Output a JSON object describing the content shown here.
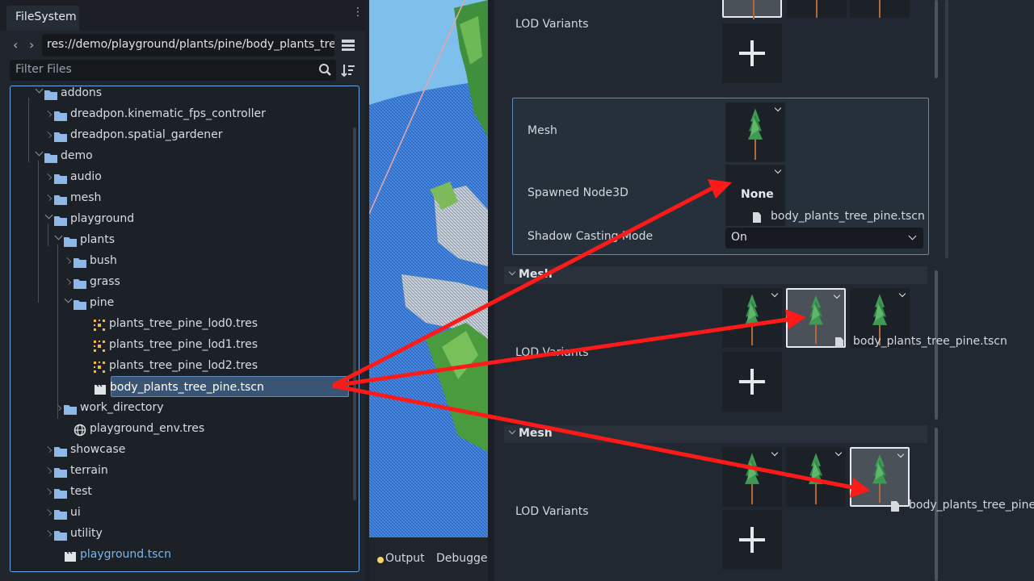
{
  "dock": {
    "tab": "FileSystem",
    "path": "res://demo/playground/plants/pine/body_plants_tree",
    "filter_placeholder": "Filter Files"
  },
  "tree": [
    {
      "label": "addons",
      "type": "folder",
      "state": "expanded"
    },
    {
      "label": "dreadpon.kinematic_fps_controller",
      "type": "folder",
      "state": "collapsed"
    },
    {
      "label": "dreadpon.spatial_gardener",
      "type": "folder",
      "state": "collapsed"
    },
    {
      "label": "demo",
      "type": "folder",
      "state": "expanded"
    },
    {
      "label": "audio",
      "type": "folder",
      "state": "collapsed"
    },
    {
      "label": "mesh",
      "type": "folder",
      "state": "collapsed"
    },
    {
      "label": "playground",
      "type": "folder",
      "state": "expanded"
    },
    {
      "label": "plants",
      "type": "folder",
      "state": "expanded"
    },
    {
      "label": "bush",
      "type": "folder",
      "state": "collapsed"
    },
    {
      "label": "grass",
      "type": "folder",
      "state": "collapsed"
    },
    {
      "label": "pine",
      "type": "folder",
      "state": "expanded"
    },
    {
      "label": "plants_tree_pine_lod0.tres",
      "type": "mesh-resource"
    },
    {
      "label": "plants_tree_pine_lod1.tres",
      "type": "mesh-resource"
    },
    {
      "label": "plants_tree_pine_lod2.tres",
      "type": "mesh-resource"
    },
    {
      "label": "body_plants_tree_pine.tscn",
      "type": "scene",
      "selected": true
    },
    {
      "label": "work_directory",
      "type": "folder",
      "state": "collapsed"
    },
    {
      "label": "playground_env.tres",
      "type": "environment"
    },
    {
      "label": "showcase",
      "type": "folder",
      "state": "collapsed"
    },
    {
      "label": "terrain",
      "type": "folder",
      "state": "collapsed"
    },
    {
      "label": "test",
      "type": "folder",
      "state": "collapsed"
    },
    {
      "label": "ui",
      "type": "folder",
      "state": "collapsed"
    },
    {
      "label": "utility",
      "type": "folder",
      "state": "collapsed"
    },
    {
      "label": "playground.tscn",
      "type": "scene",
      "highlight": true
    }
  ],
  "bottom_panel": {
    "output": "Output",
    "debugger": "Debugger"
  },
  "inspector": {
    "lod_variants_label": "LOD Variants",
    "mesh_label": "Mesh",
    "spawned_label": "Spawned Node3D",
    "spawned_value": "None",
    "dragged_file": "body_plants_tree_pine.tscn",
    "shadow_label": "Shadow Casting Mode",
    "shadow_value": "On",
    "section_mesh": "Mesh",
    "dragged_file_truncated": "body_plants_tree_pine.t"
  },
  "colors": {
    "accent": "#6aa8e8",
    "arrow": "#ff1a1a",
    "folder": "#8fb8e6",
    "link": "#7fb4e8"
  }
}
